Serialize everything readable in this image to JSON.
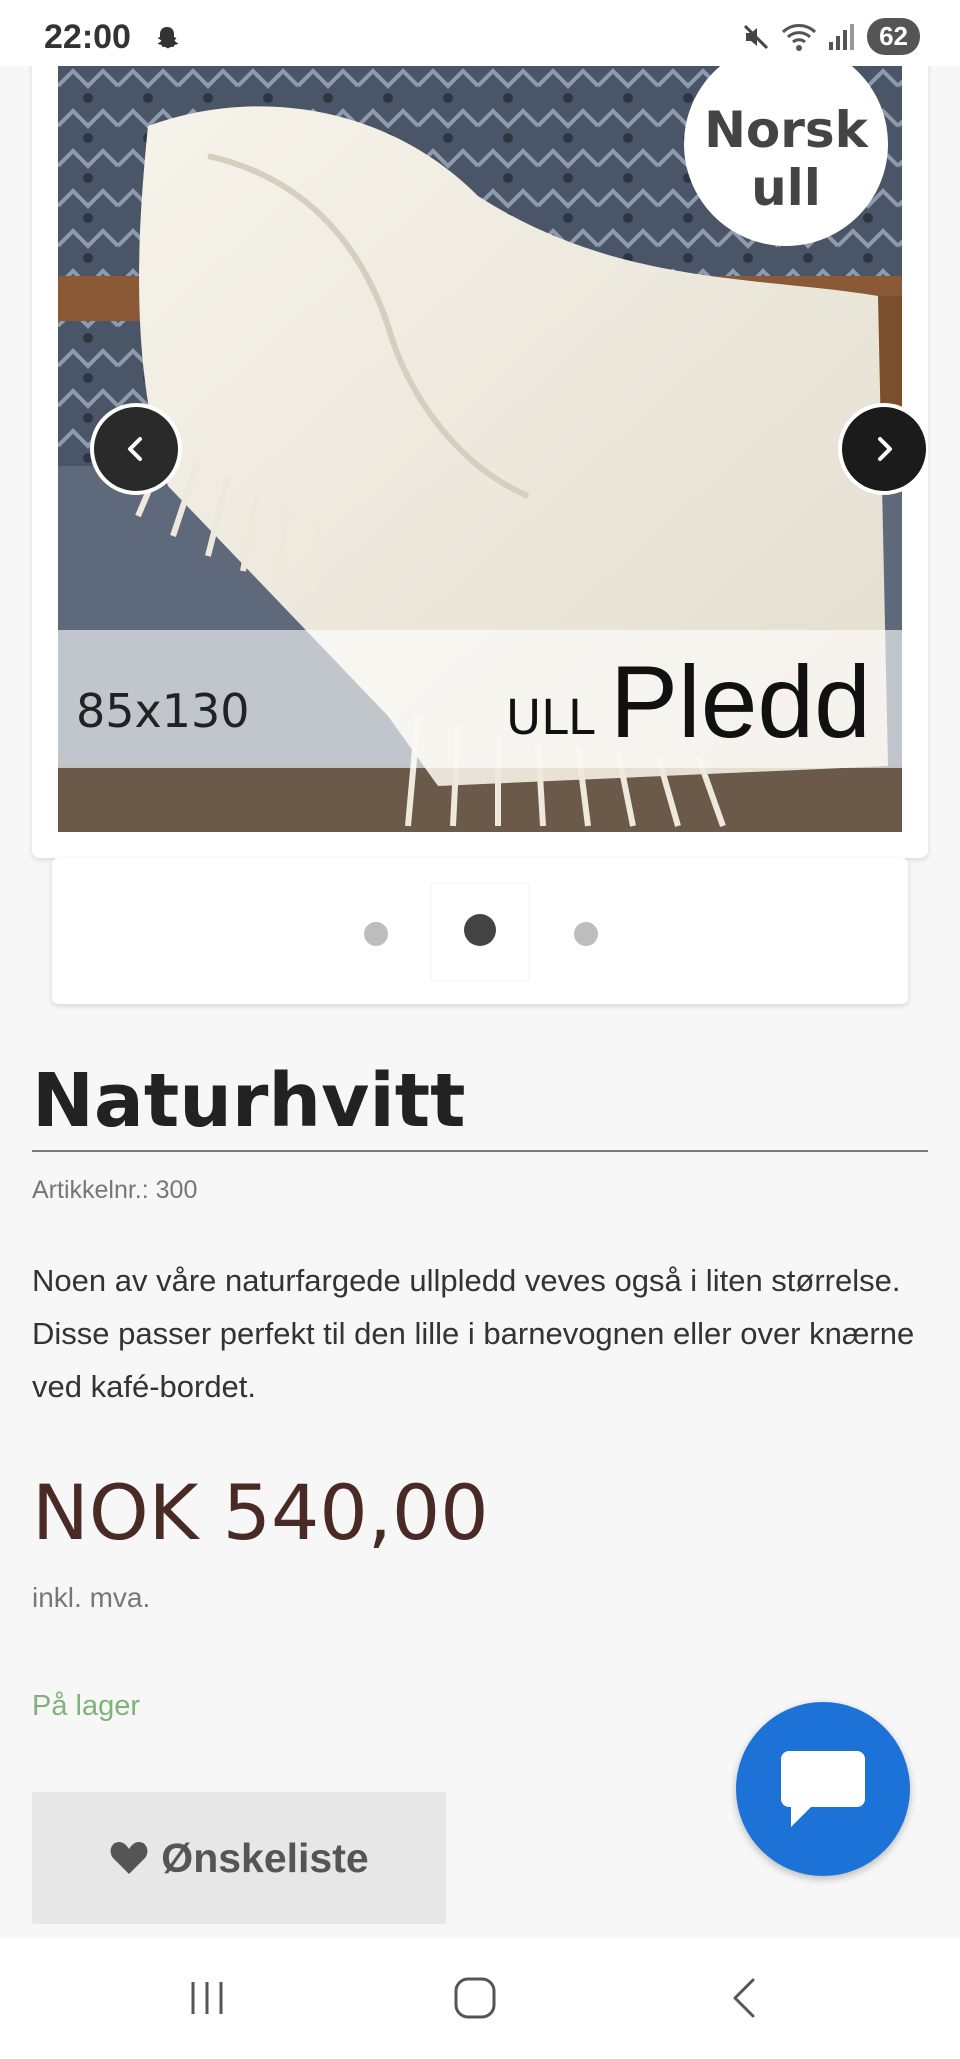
{
  "status_bar": {
    "time": "22:00",
    "battery": "62"
  },
  "gallery": {
    "badge_line1": "Norsk",
    "badge_line2": "ull",
    "size_text": "85x130",
    "ull_text": "ULL",
    "pledd_text": "Pledd",
    "slide_count": 3,
    "active_slide": 2
  },
  "product": {
    "title": "Naturhvitt",
    "article_number": "Artikkelnr.: 300",
    "description": "Noen av våre naturfargede ullpledd veves også i liten størrelse. Disse passer perfekt til den lille i barnevognen eller over knærne ved kafé-bordet.",
    "price": "NOK 540,00",
    "vat_note": "inkl. mva.",
    "stock_status": "På lager",
    "wishlist_label": "Ønskeliste"
  },
  "colors": {
    "price": "#4a2a24",
    "stock": "#7fb37a",
    "chat_button": "#1d72d8"
  },
  "icons": {
    "prev": "chevron-left-icon",
    "next": "chevron-right-icon",
    "wishlist": "heart-icon",
    "chat": "chat-bubble-icon",
    "recents": "recents-icon",
    "home": "home-icon",
    "back": "back-icon"
  }
}
